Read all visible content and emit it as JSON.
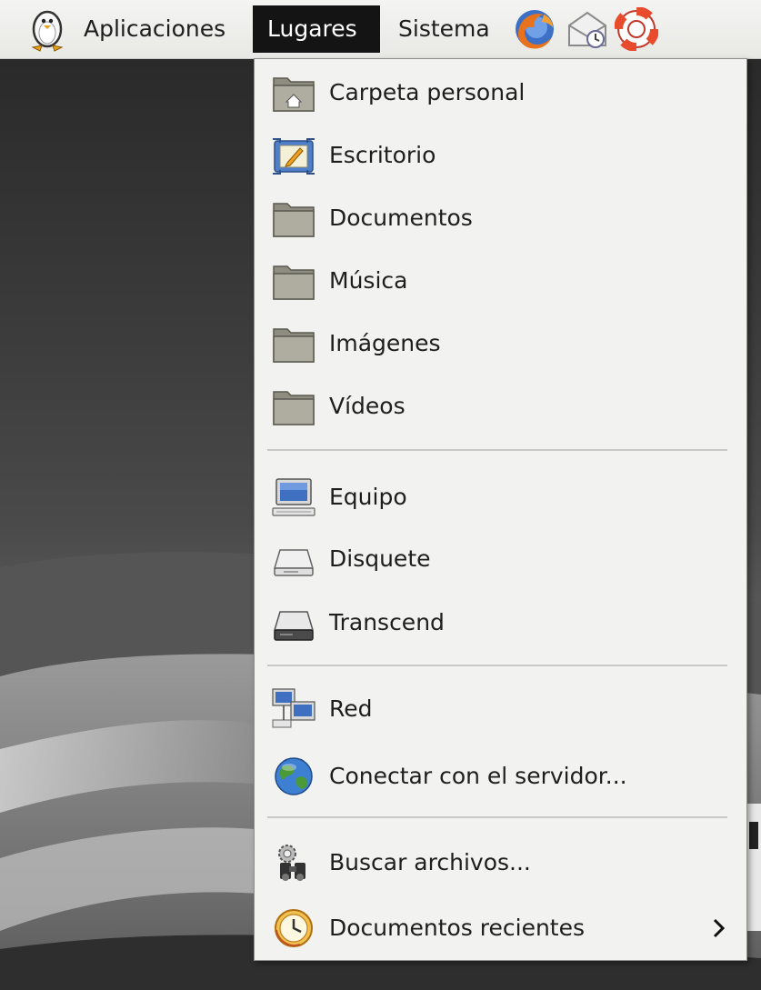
{
  "panel": {
    "menus": [
      {
        "label": "Aplicaciones"
      },
      {
        "label": "Lugares"
      },
      {
        "label": "Sistema"
      }
    ],
    "launchers": [
      "firefox-icon",
      "mail-icon",
      "help-icon"
    ]
  },
  "places_menu": {
    "items": [
      {
        "label": "Carpeta personal",
        "icon": "home-folder-icon"
      },
      {
        "label": "Escritorio",
        "icon": "desktop-folder-icon"
      },
      {
        "label": "Documentos",
        "icon": "folder-icon"
      },
      {
        "label": "Música",
        "icon": "folder-icon"
      },
      {
        "label": "Imágenes",
        "icon": "folder-icon"
      },
      {
        "label": "Vídeos",
        "icon": "folder-icon"
      },
      {
        "label": "Equipo",
        "icon": "computer-icon"
      },
      {
        "label": "Disquete",
        "icon": "floppy-drive-icon"
      },
      {
        "label": "Transcend",
        "icon": "removable-drive-icon"
      },
      {
        "label": "Red",
        "icon": "network-icon"
      },
      {
        "label": "Conectar con el servidor...",
        "icon": "globe-icon"
      },
      {
        "label": "Buscar archivos...",
        "icon": "search-files-icon"
      },
      {
        "label": "Documentos recientes",
        "icon": "recent-documents-icon",
        "has_submenu": true
      }
    ]
  },
  "colors": {
    "selected_menu_bg": "#141414",
    "menu_bg": "#f2f2f1",
    "folder": "#a6a596"
  }
}
